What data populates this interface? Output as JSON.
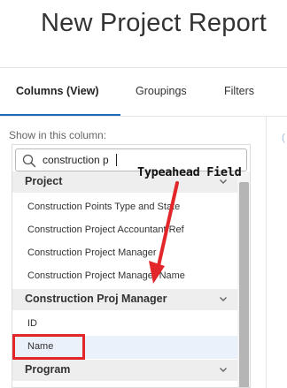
{
  "page": {
    "title": "New Project Report"
  },
  "tabs": [
    {
      "label": "Columns (View)",
      "active": true
    },
    {
      "label": "Groupings",
      "active": false
    },
    {
      "label": "Filters",
      "active": false
    }
  ],
  "column_picker": {
    "show_label": "Show in this column:",
    "search": {
      "value": "construction p",
      "icon": "search-icon"
    },
    "groups": [
      {
        "label": "Project",
        "items": [
          "Construction Points Type and State",
          "Construction Project Accountant Ref",
          "Construction Project Manager",
          "Construction Project Manager Name"
        ]
      },
      {
        "label": "Construction Proj Manager",
        "items": [
          "ID",
          "Name"
        ]
      },
      {
        "label": "Program",
        "items": []
      }
    ],
    "hovered_item": "Name"
  },
  "annotation": {
    "label": "Typeahead Field",
    "color": "#e3262a"
  },
  "colors": {
    "accent": "#1a6bb8",
    "annotation_red": "#e3262a"
  }
}
